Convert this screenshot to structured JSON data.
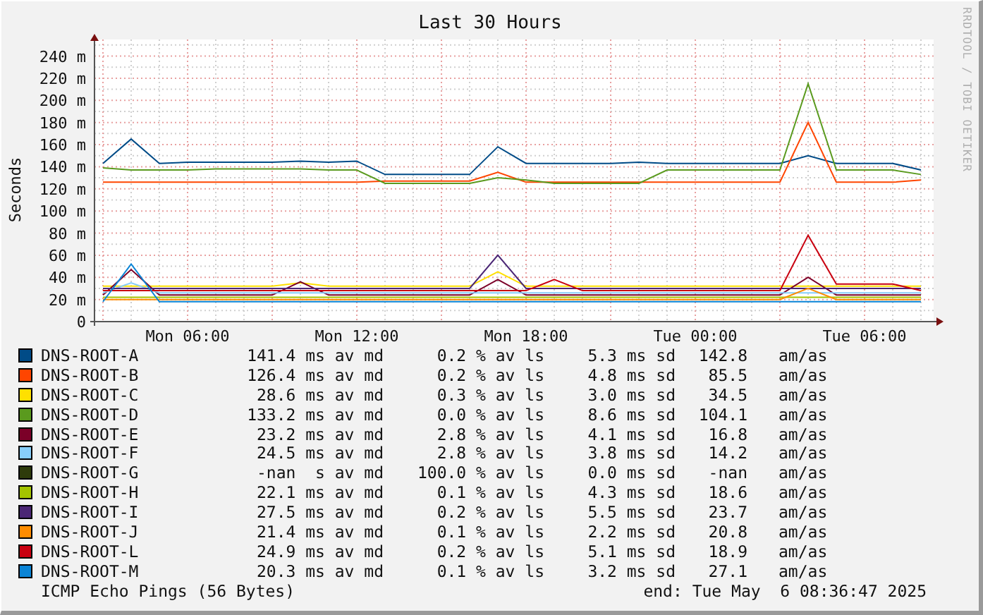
{
  "title": "Last 30 Hours",
  "watermark": "RRDTOOL / TOBI OETIKER",
  "chart_data": {
    "type": "line",
    "ylabel": "Seconds",
    "grid": true,
    "ylim": [
      0,
      255
    ],
    "categories": [
      null,
      null,
      null,
      "Mon 06:00",
      null,
      null,
      null,
      null,
      null,
      "Mon 12:00",
      null,
      null,
      null,
      null,
      null,
      "Mon 18:00",
      null,
      null,
      null,
      null,
      null,
      "Tue 00:00",
      null,
      null,
      null,
      null,
      null,
      "Tue 06:00",
      null,
      null
    ],
    "yticks": [
      {
        "value": 0,
        "label": "0"
      },
      {
        "value": 20,
        "label": "20 m"
      },
      {
        "value": 40,
        "label": "40 m"
      },
      {
        "value": 60,
        "label": "60 m"
      },
      {
        "value": 80,
        "label": "80 m"
      },
      {
        "value": 100,
        "label": "100 m"
      },
      {
        "value": 120,
        "label": "120 m"
      },
      {
        "value": 140,
        "label": "140 m"
      },
      {
        "value": 160,
        "label": "160 m"
      },
      {
        "value": 180,
        "label": "180 m"
      },
      {
        "value": 200,
        "label": "200 m"
      },
      {
        "value": 220,
        "label": "220 m"
      },
      {
        "value": 240,
        "label": "240 m"
      }
    ],
    "series": [
      {
        "name": "DNS-ROOT-A",
        "color": "#004b87",
        "values": [
          143,
          165,
          143,
          144,
          144,
          144,
          144,
          145,
          144,
          145,
          133,
          133,
          133,
          133,
          158,
          143,
          143,
          143,
          143,
          144,
          143,
          143,
          143,
          143,
          143,
          150,
          143,
          143,
          143,
          137
        ]
      },
      {
        "name": "DNS-ROOT-B",
        "color": "#ff4500",
        "values": [
          126,
          126,
          126,
          126,
          126,
          126,
          126,
          126,
          126,
          126,
          127,
          127,
          127,
          127,
          135,
          126,
          126,
          126,
          126,
          126,
          126,
          126,
          126,
          126,
          126,
          180,
          126,
          126,
          126,
          128
        ]
      },
      {
        "name": "DNS-ROOT-C",
        "color": "#ffe000",
        "values": [
          32,
          32,
          32,
          32,
          32,
          32,
          32,
          35,
          32,
          32,
          32,
          32,
          32,
          32,
          45,
          32,
          32,
          32,
          32,
          32,
          32,
          32,
          32,
          32,
          32,
          32,
          32,
          32,
          32,
          32
        ]
      },
      {
        "name": "DNS-ROOT-D",
        "color": "#5a9a1e",
        "values": [
          139,
          137,
          137,
          137,
          138,
          138,
          138,
          138,
          137,
          137,
          125,
          125,
          125,
          125,
          130,
          128,
          125,
          125,
          125,
          125,
          137,
          137,
          137,
          137,
          137,
          215,
          137,
          137,
          137,
          133
        ]
      },
      {
        "name": "DNS-ROOT-E",
        "color": "#7b0028",
        "values": [
          24,
          47,
          24,
          24,
          24,
          24,
          24,
          36,
          24,
          24,
          24,
          24,
          24,
          24,
          38,
          24,
          24,
          24,
          24,
          24,
          24,
          24,
          24,
          24,
          24,
          40,
          24,
          24,
          24,
          24
        ]
      },
      {
        "name": "DNS-ROOT-F",
        "color": "#87cefa",
        "values": [
          26,
          35,
          26,
          26,
          26,
          26,
          26,
          26,
          26,
          26,
          26,
          26,
          26,
          26,
          26,
          26,
          26,
          26,
          26,
          26,
          26,
          26,
          26,
          26,
          26,
          26,
          26,
          26,
          26,
          26
        ]
      },
      {
        "name": "DNS-ROOT-G",
        "color": "#2e3b0b",
        "values": [
          null,
          null,
          null,
          null,
          null,
          null,
          null,
          null,
          null,
          null,
          null,
          null,
          null,
          null,
          null,
          null,
          null,
          null,
          null,
          null,
          null,
          null,
          null,
          null,
          null,
          null,
          null,
          null,
          null,
          null
        ]
      },
      {
        "name": "DNS-ROOT-H",
        "color": "#a4c400",
        "values": [
          22,
          22,
          22,
          22,
          22,
          22,
          22,
          22,
          22,
          22,
          22,
          22,
          22,
          22,
          22,
          22,
          22,
          22,
          22,
          22,
          22,
          22,
          22,
          22,
          22,
          22,
          22,
          22,
          22,
          22
        ]
      },
      {
        "name": "DNS-ROOT-I",
        "color": "#4b2675",
        "values": [
          30,
          30,
          30,
          30,
          30,
          30,
          30,
          30,
          30,
          30,
          30,
          30,
          30,
          30,
          60,
          30,
          30,
          30,
          30,
          30,
          30,
          30,
          30,
          30,
          30,
          30,
          30,
          30,
          30,
          30
        ]
      },
      {
        "name": "DNS-ROOT-J",
        "color": "#ff8c00",
        "values": [
          20,
          20,
          20,
          20,
          20,
          20,
          20,
          20,
          20,
          20,
          20,
          20,
          20,
          20,
          20,
          20,
          20,
          20,
          20,
          20,
          20,
          20,
          20,
          20,
          20,
          30,
          20,
          20,
          20,
          20
        ]
      },
      {
        "name": "DNS-ROOT-L",
        "color": "#c90010",
        "values": [
          28,
          28,
          28,
          28,
          28,
          28,
          28,
          28,
          28,
          28,
          28,
          28,
          28,
          28,
          28,
          28,
          38,
          28,
          28,
          28,
          28,
          28,
          28,
          28,
          28,
          78,
          34,
          34,
          34,
          28
        ]
      },
      {
        "name": "DNS-ROOT-M",
        "color": "#0a84d6",
        "values": [
          18,
          52,
          18,
          18,
          18,
          18,
          18,
          18,
          18,
          18,
          18,
          18,
          18,
          18,
          18,
          18,
          18,
          18,
          18,
          18,
          18,
          18,
          18,
          18,
          18,
          18,
          18,
          18,
          18,
          18
        ]
      }
    ]
  },
  "legend": [
    {
      "median": "141.4 ms av md",
      "loss": "0.2 % av ls",
      "sd": "5.3 ms sd",
      "ratio": "142.8",
      "ratio_unit": "am/as"
    },
    {
      "median": "126.4 ms av md",
      "loss": "0.2 % av ls",
      "sd": "4.8 ms sd",
      "ratio": "85.5",
      "ratio_unit": "am/as"
    },
    {
      "median": "28.6 ms av md",
      "loss": "0.3 % av ls",
      "sd": "3.0 ms sd",
      "ratio": "34.5",
      "ratio_unit": "am/as"
    },
    {
      "median": "133.2 ms av md",
      "loss": "0.0 % av ls",
      "sd": "8.6 ms sd",
      "ratio": "104.1",
      "ratio_unit": "am/as"
    },
    {
      "median": "23.2 ms av md",
      "loss": "2.8 % av ls",
      "sd": "4.1 ms sd",
      "ratio": "16.8",
      "ratio_unit": "am/as"
    },
    {
      "median": "24.5 ms av md",
      "loss": "2.8 % av ls",
      "sd": "3.8 ms sd",
      "ratio": "14.2",
      "ratio_unit": "am/as"
    },
    {
      "median": "-nan  s av md",
      "loss": "100.0 % av ls",
      "sd": "0.0 ms sd",
      "ratio": "-nan",
      "ratio_unit": "am/as"
    },
    {
      "median": "22.1 ms av md",
      "loss": "0.1 % av ls",
      "sd": "4.3 ms sd",
      "ratio": "18.6",
      "ratio_unit": "am/as"
    },
    {
      "median": "27.5 ms av md",
      "loss": "0.2 % av ls",
      "sd": "5.5 ms sd",
      "ratio": "23.7",
      "ratio_unit": "am/as"
    },
    {
      "median": "21.4 ms av md",
      "loss": "0.1 % av ls",
      "sd": "2.2 ms sd",
      "ratio": "20.8",
      "ratio_unit": "am/as"
    },
    {
      "median": "24.9 ms av md",
      "loss": "0.2 % av ls",
      "sd": "5.1 ms sd",
      "ratio": "18.9",
      "ratio_unit": "am/as"
    },
    {
      "median": "20.3 ms av md",
      "loss": "0.1 % av ls",
      "sd": "3.2 ms sd",
      "ratio": "27.1",
      "ratio_unit": "am/as"
    }
  ],
  "footer": {
    "probe": "ICMP Echo Pings (56 Bytes)",
    "end": "end: Tue May  6 08:36:47 2025"
  }
}
